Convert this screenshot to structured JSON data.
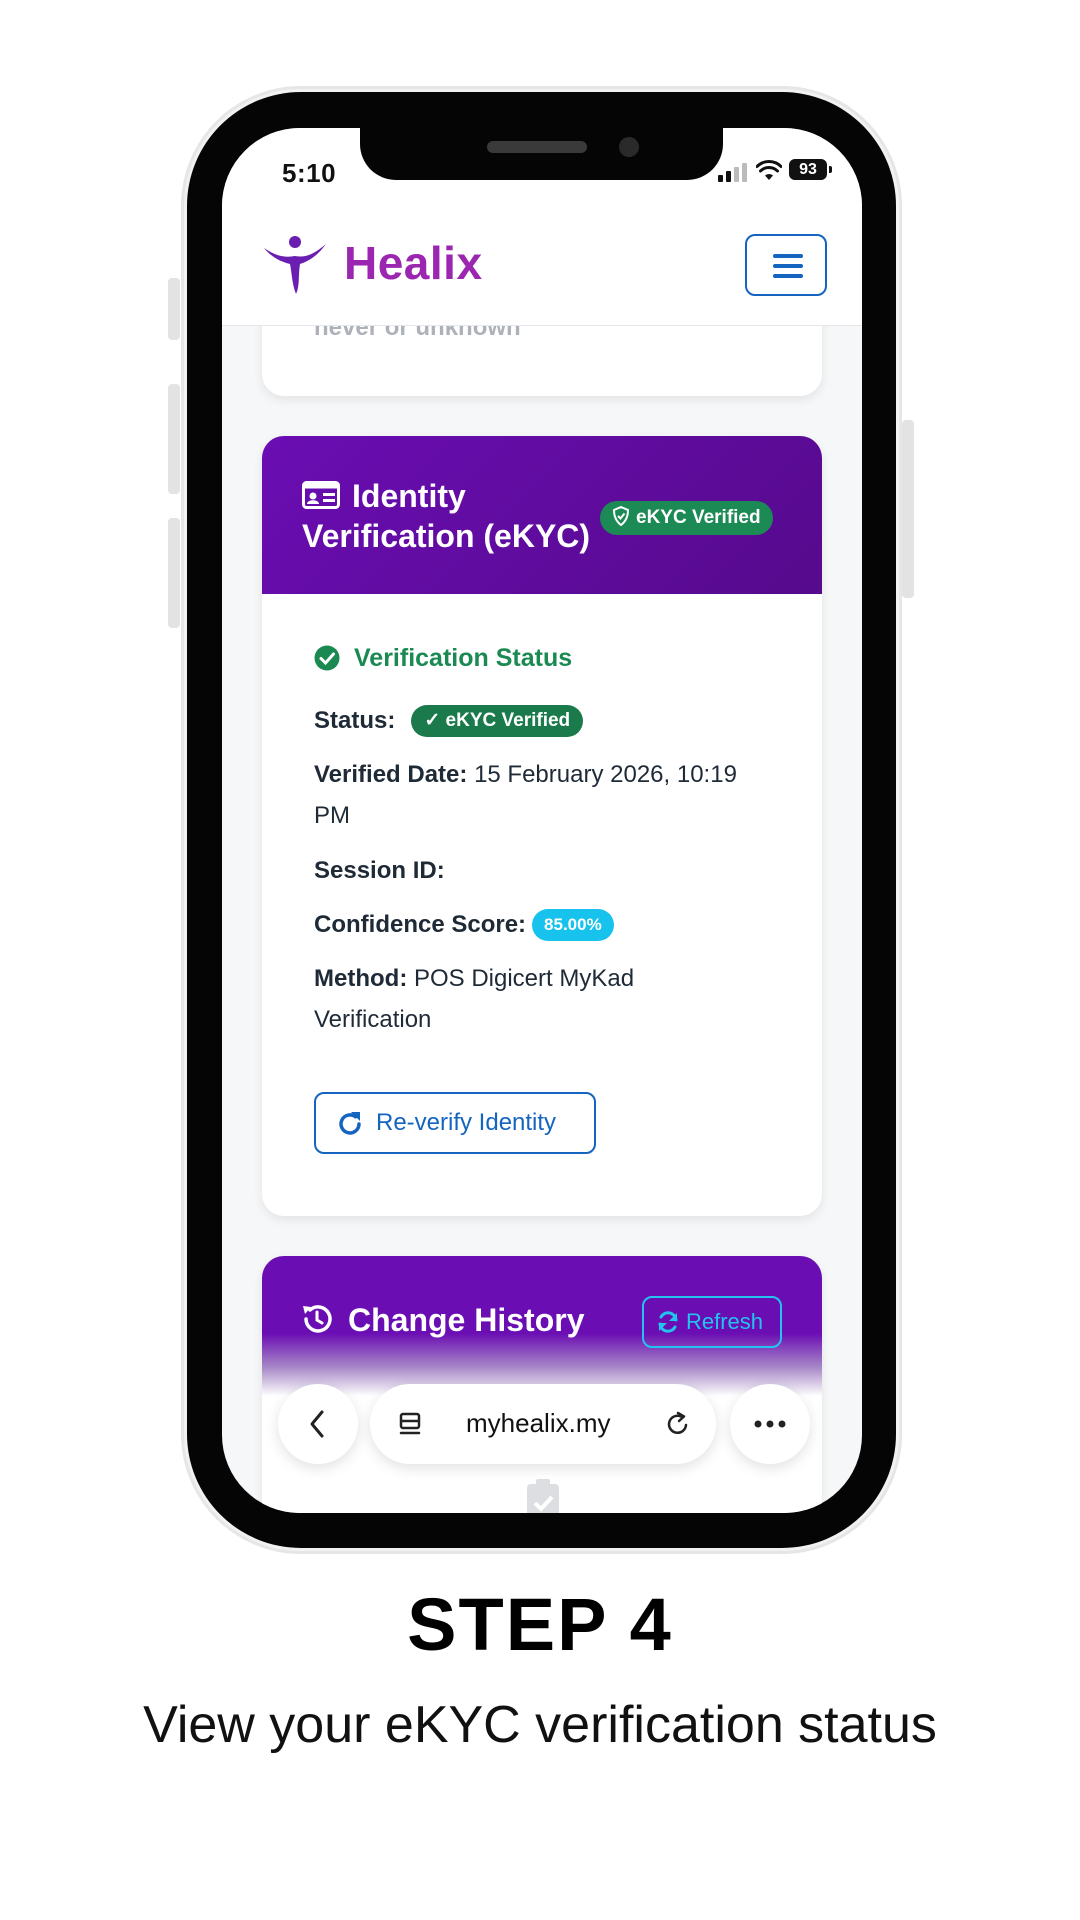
{
  "status_bar": {
    "time": "5:10",
    "battery": "93"
  },
  "header": {
    "brand": "Healix",
    "menu_icon": "hamburger-menu-icon"
  },
  "previous_card": {
    "partial_text": "never or unknown"
  },
  "ekyc_card": {
    "title": "Identity Verification (eKYC)",
    "badge": "eKYC Verified",
    "section_title": "Verification Status",
    "status_label": "Status:",
    "status_value": "✓ eKYC Verified",
    "verified_date_label": "Verified Date:",
    "verified_date_value": "15 February 2026, 10:19 PM",
    "session_id_label": "Session ID:",
    "confidence_label": "Confidence Score:",
    "confidence_value": "85.00%",
    "method_label": "Method:",
    "method_value": "POS Digicert MyKad Verification",
    "reverify_button": "Re-verify Identity",
    "colors": {
      "header": "#6a0db3",
      "success": "#1b8a52",
      "info": "#17c3ec",
      "primary": "#1565c0"
    }
  },
  "history_card": {
    "title": "Change History",
    "refresh_button": "Refresh"
  },
  "browser_bar": {
    "url": "myhealix.my"
  },
  "caption": {
    "step": "STEP 4",
    "description": "View your eKYC verification status"
  }
}
